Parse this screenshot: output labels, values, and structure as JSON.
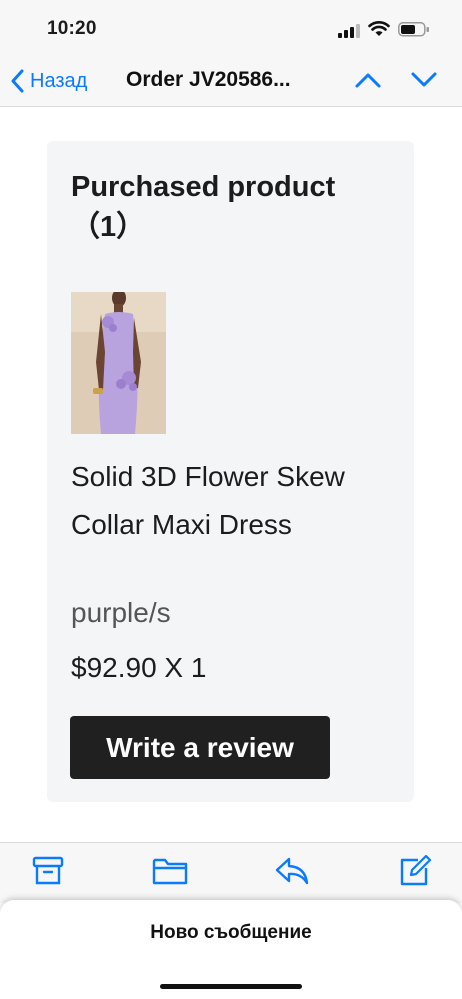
{
  "status": {
    "time": "10:20"
  },
  "nav": {
    "back_label": "Назад",
    "title": "Order JV20586...",
    "accent": "#0a7aff"
  },
  "email": {
    "cut_off_text": "...",
    "card": {
      "title": "Purchased product （1）",
      "product": {
        "name": "Solid 3D Flower Skew Collar Maxi Dress",
        "variant": "purple/s",
        "price": "$92.90 X 1",
        "dress_color": "#b9a3df"
      },
      "review_button": "Write a review"
    }
  },
  "toolbar": {
    "icons": [
      "archive-icon",
      "folder-icon",
      "reply-icon",
      "compose-icon"
    ]
  },
  "sheet": {
    "title": "Ново съобщение"
  }
}
